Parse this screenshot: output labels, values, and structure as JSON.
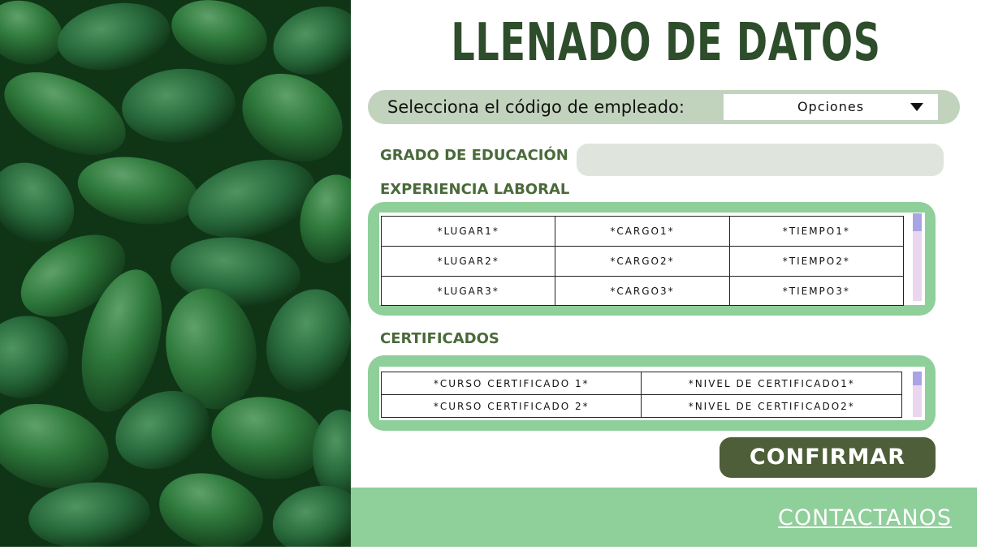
{
  "title": "LLENADO DE DATOS",
  "employee": {
    "label": "Selecciona el código de empleado:",
    "select_value": "Opciones"
  },
  "education": {
    "label": "GRADO DE EDUCACIÓN",
    "value": ""
  },
  "experience": {
    "label": "EXPERIENCIA LABORAL",
    "rows": [
      [
        "*LUGAR1*",
        "*CARGO1*",
        "*TIEMPO1*"
      ],
      [
        "*LUGAR2*",
        "*CARGO2*",
        "*TIEMPO2*"
      ],
      [
        "*LUGAR3*",
        "*CARGO3*",
        "*TIEMPO3*"
      ]
    ]
  },
  "certificates": {
    "label": "CERTIFICADOS",
    "rows": [
      [
        "*CURSO CERTIFICADO 1*",
        "*NIVEL DE CERTIFICADO1*"
      ],
      [
        "*CURSO CERTIFICADO 2*",
        "*NIVEL DE CERTIFICADO2*"
      ]
    ]
  },
  "confirm_label": "CONFIRMAR",
  "footer": {
    "contact_label": "CONTACTANOS"
  },
  "colors": {
    "title": "#2e4d2b",
    "accent_green": "#8fcf9a",
    "button": "#4d5e38",
    "selector_bar": "#c2d3bd"
  },
  "image": {
    "description_icon": "avocado-photo"
  }
}
